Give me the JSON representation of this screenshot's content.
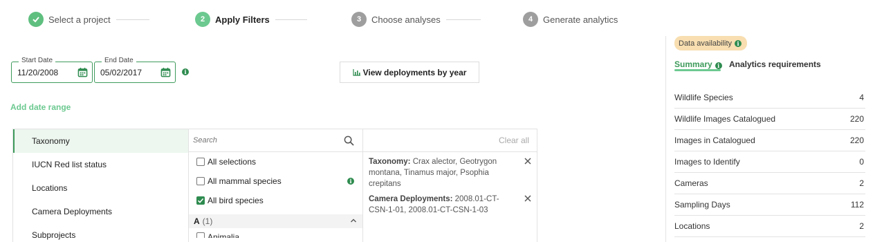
{
  "stepper": {
    "steps": [
      {
        "number": "1",
        "label": "Select a project",
        "state": "done"
      },
      {
        "number": "2",
        "label": "Apply Filters",
        "state": "active"
      },
      {
        "number": "3",
        "label": "Choose analyses",
        "state": "pending"
      },
      {
        "number": "4",
        "label": "Generate analytics",
        "state": "pending"
      }
    ]
  },
  "dates": {
    "start_label": "Start Date",
    "start_value": "11/20/2008",
    "end_label": "End Date",
    "end_value": "05/02/2017"
  },
  "view_deployments_label": "View deployments by year",
  "add_date_range_label": "Add date range",
  "filters": {
    "categories": [
      "Taxonomy",
      "IUCN Red list status",
      "Locations",
      "Camera Deployments",
      "Subprojects"
    ],
    "active_category": "Taxonomy",
    "search_placeholder": "Search",
    "options": [
      {
        "label": "All selections",
        "checked": false
      },
      {
        "label": "All mammal species",
        "checked": false
      },
      {
        "label": "All bird species",
        "checked": true
      }
    ],
    "group": {
      "letter": "A",
      "count": "(1)"
    },
    "partial_option": "Animalia",
    "clear_all_label": "Clear all",
    "selected": [
      {
        "key": "Taxonomy:",
        "value": " Crax alector, Geotrygon montana, Tinamus major, Psophia crepitans"
      },
      {
        "key": "Camera Deployments:",
        "value": " 2008.01-CT-CSN-1-01, 2008.01-CT-CSN-1-03"
      }
    ]
  },
  "sidebar": {
    "badge": "Data availability",
    "tabs": [
      "Summary",
      "Analytics requirements"
    ],
    "stats": [
      {
        "label": "Wildlife Species",
        "value": "4"
      },
      {
        "label": "Wildlife Images Catalogued",
        "value": "220"
      },
      {
        "label": "Images in Catalogued",
        "value": "220"
      },
      {
        "label": "Images to Identify",
        "value": "0"
      },
      {
        "label": "Cameras",
        "value": "2"
      },
      {
        "label": "Sampling Days",
        "value": "112"
      },
      {
        "label": "Locations",
        "value": "2"
      }
    ]
  },
  "colors": {
    "accent": "#6cc990",
    "accent_dark": "#3d9a5a",
    "badge": "#f8deb0"
  }
}
